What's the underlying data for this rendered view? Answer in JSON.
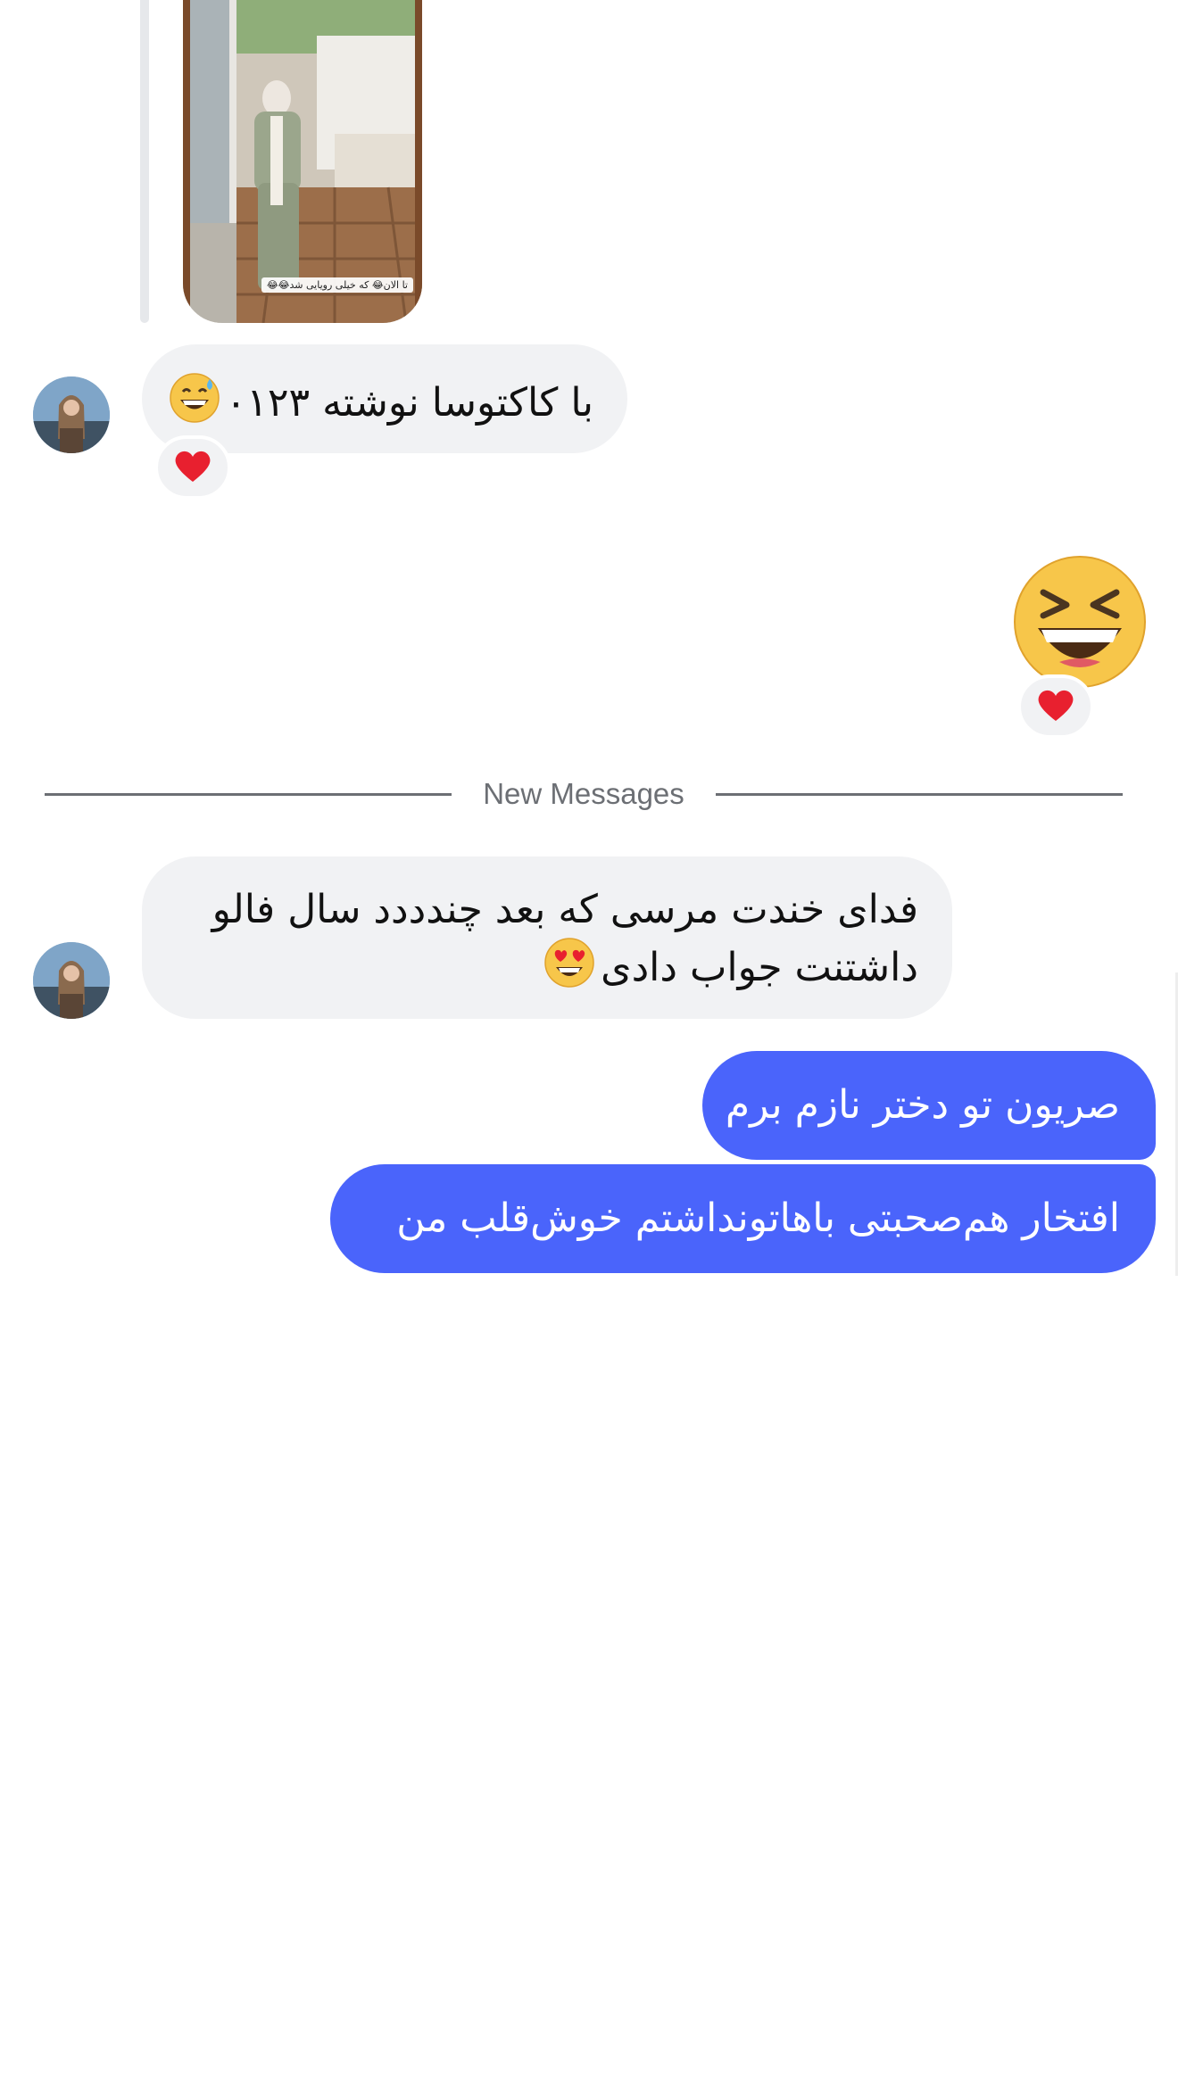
{
  "story_reply": {
    "caption": "تا الان😂 که خیلی رویایی شد😂😂"
  },
  "messages": [
    {
      "text": "با کاکتوسا نوشته ۰۱۲۳",
      "emoji": "grinning-face-with-sweat",
      "reaction": "red-heart"
    },
    {
      "emoji": "grinning-squinting-face",
      "reaction": "red-heart"
    },
    {
      "line1": "فدای خندت مرسی که بعد چندددد سال فالو",
      "line2": "داشتنت جواب دادی",
      "emoji": "smiling-face-with-heart-eyes"
    },
    {
      "text": "صریون تو دختر نازم برم"
    },
    {
      "text": "افتخار هم‌صحبتی باهاتونداشتم خوش‌قلب من"
    }
  ],
  "divider": {
    "label": "New Messages"
  },
  "colors": {
    "incoming_bubble": "#f1f2f4",
    "outgoing_bubble": "#4a64fb",
    "divider": "#6c6f74",
    "heart": "#e8202f",
    "emoji_yellow": "#f7c64a"
  }
}
